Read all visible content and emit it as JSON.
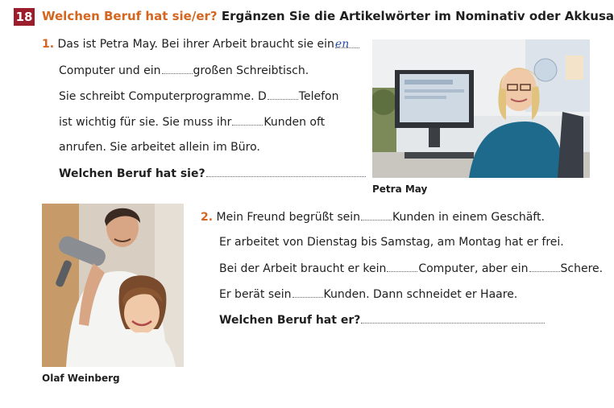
{
  "header": {
    "number": "18",
    "title_accent": "Welchen Beruf hat sie/er?",
    "title_rest": "Ergänzen Sie die Artikelwörter im Nominativ oder Akkusativ."
  },
  "exercise1": {
    "num": "1.",
    "l1": "Das ist Petra May. Bei ihrer Arbeit braucht sie ein",
    "l1_fill": "en",
    "l2a": "Computer und ein",
    "l2b": "großen Schreibtisch.",
    "l3a": "Sie schreibt Computerprogramme. D",
    "l3b": "Telefon",
    "l4a": "ist wichtig für sie. Sie muss ihr",
    "l4b": "Kunden oft",
    "l5": "anrufen. Sie arbeitet allein im Büro.",
    "question": "Welchen Beruf hat sie?",
    "caption": "Petra May"
  },
  "exercise2": {
    "num": "2.",
    "l1a": "Mein Freund begrüßt sein",
    "l1b": "Kunden in einem Geschäft.",
    "l2": "Er arbeitet von Dienstag bis Samstag, am Montag hat er frei.",
    "l3a": "Bei der Arbeit braucht er kein",
    "l3b": "Computer, aber ein",
    "l3c": "Schere.",
    "l4a": "Er berät sein",
    "l4b": "Kunden. Dann schneidet er Haare.",
    "question": "Welchen Beruf hat er?",
    "caption": "Olaf Weinberg"
  }
}
